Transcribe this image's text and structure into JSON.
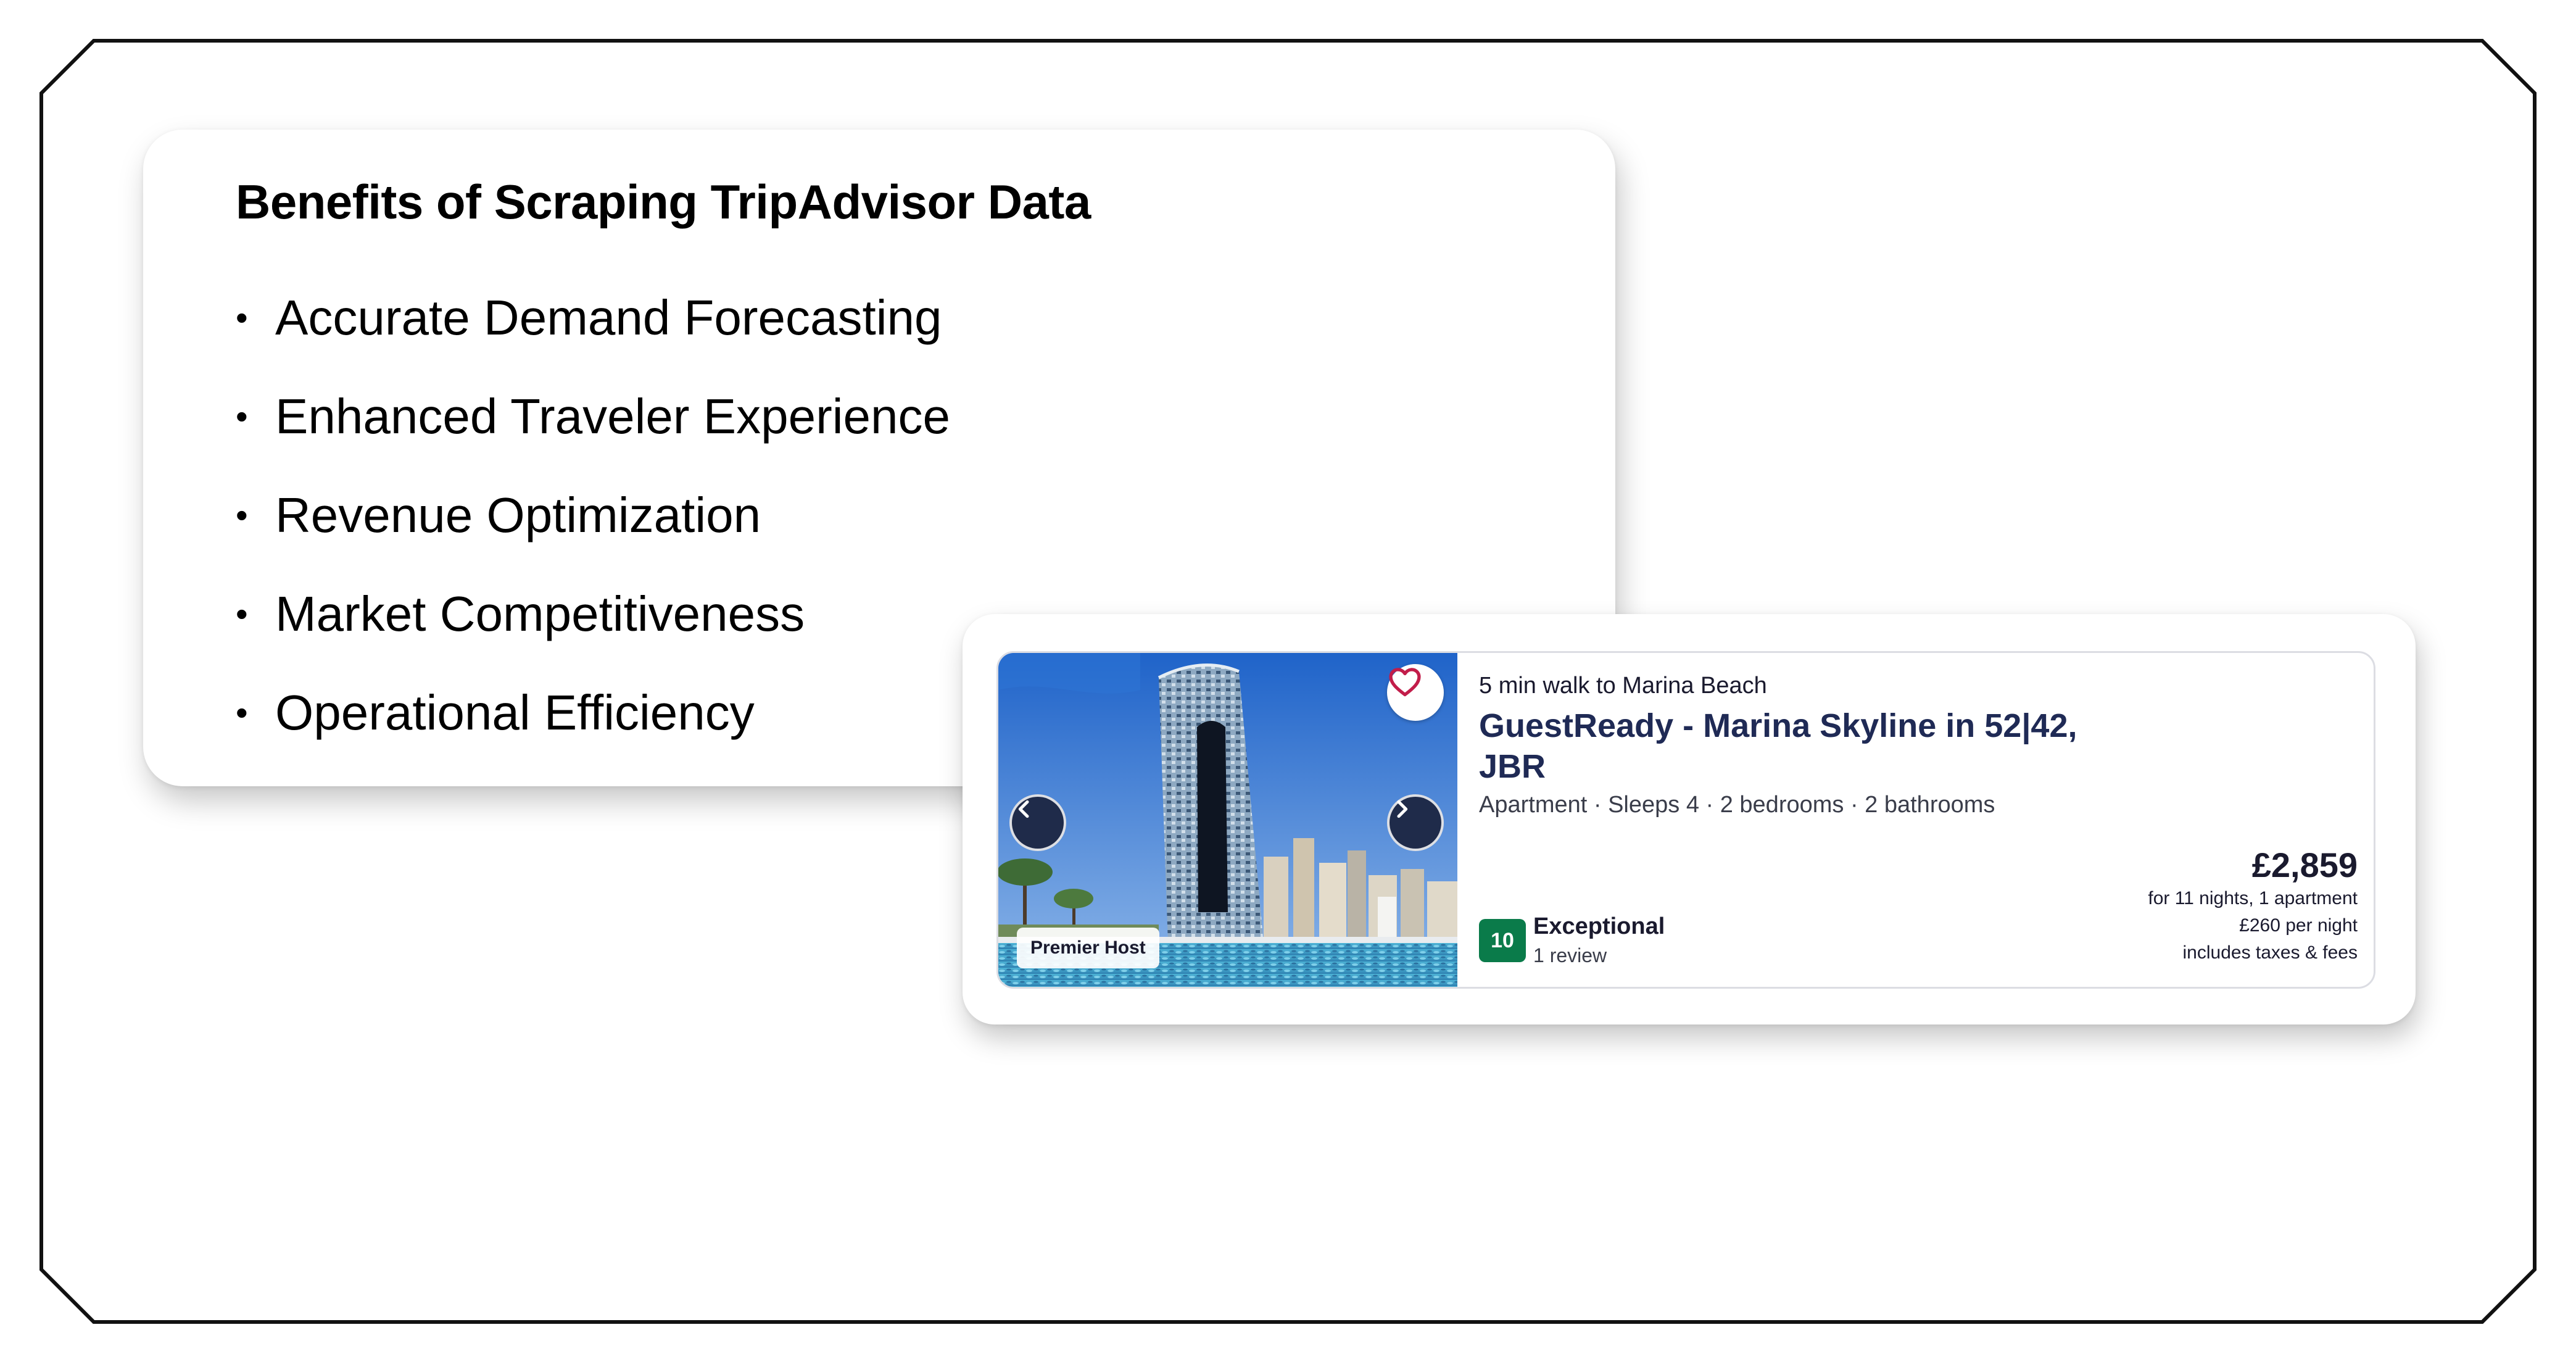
{
  "benefits": {
    "title": "Benefits of Scraping TripAdvisor Data",
    "bullet": "•",
    "items": [
      "Accurate Demand Forecasting",
      "Enhanced Traveler Experience",
      "Revenue Optimization",
      "Market Competitiveness",
      "Operational Efficiency"
    ]
  },
  "listing": {
    "walk_text": "5 min walk to Marina Beach",
    "title": "GuestReady - Marina Skyline in 52|42, JBR",
    "specs": "Apartment · Sleeps 4 · 2 bedrooms · 2 bathrooms",
    "badge": "Premier Host",
    "score": "10",
    "rating_word": "Exceptional",
    "review_count": "1 review",
    "price": "£2,859",
    "price_stay": "for 11 nights, 1 apartment",
    "price_per_night": "£260 per night",
    "price_note": "includes taxes & fees",
    "icons": {
      "prev": "chevron-left-icon",
      "next": "chevron-right-icon",
      "favorite": "heart-icon"
    },
    "colors": {
      "score_badge": "#0a7b4a",
      "title": "#1f2a55",
      "nav_button": "#1f2b4a",
      "heart": "#c21d4a"
    }
  }
}
